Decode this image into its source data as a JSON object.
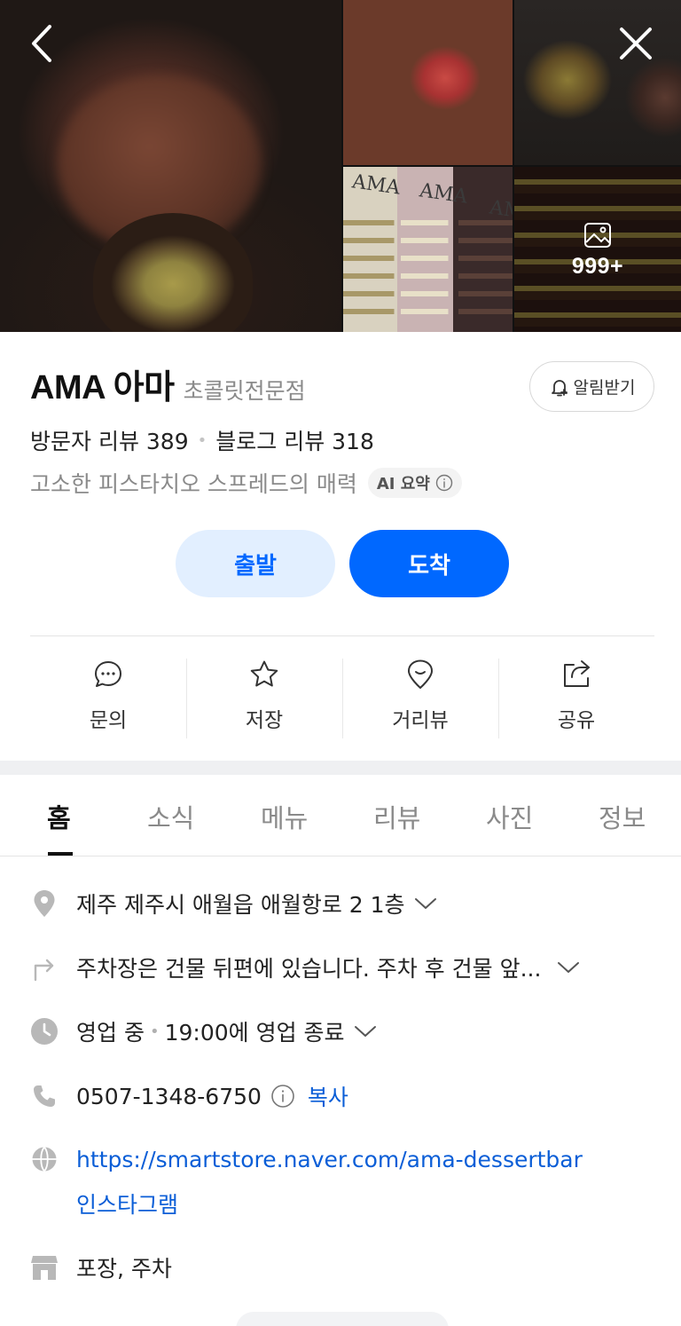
{
  "gallery": {
    "photo_count": "999+",
    "photo_labels": [
      "AMA",
      "AMA",
      "AM"
    ]
  },
  "header": {
    "name": "AMA 아마",
    "category": "초콜릿전문점",
    "alert_label": "알림받기",
    "visitor_reviews": "방문자 리뷰 389",
    "blog_reviews": "블로그 리뷰 318",
    "summary": "고소한 피스타치오 스프레드의 매력",
    "ai_badge": "AI 요약"
  },
  "directions": {
    "depart_label": "출발",
    "arrive_label": "도착"
  },
  "actions": [
    {
      "label": "문의",
      "icon": "chat-icon"
    },
    {
      "label": "저장",
      "icon": "star-icon"
    },
    {
      "label": "거리뷰",
      "icon": "map-pin-icon"
    },
    {
      "label": "공유",
      "icon": "share-icon"
    }
  ],
  "tabs": [
    {
      "label": "홈",
      "active": true
    },
    {
      "label": "소식"
    },
    {
      "label": "메뉴"
    },
    {
      "label": "리뷰"
    },
    {
      "label": "사진"
    },
    {
      "label": "정보"
    }
  ],
  "info": {
    "address": "제주 제주시 애월읍 애월항로 2 1층",
    "directions_note": "주차장은 건물 뒤편에 있습니다. 주차 후 건물 앞...",
    "hours_status": "영업 중",
    "hours_detail": "19:00에 영업 종료",
    "phone": "0507-1348-6750",
    "copy_label": "복사",
    "website": "https://smartstore.naver.com/ama-dessertbar",
    "instagram": "인스타그램",
    "amenities": "포장, 주차"
  },
  "colors": {
    "accent": "#0068ff",
    "accent_light": "#e2efff",
    "link": "#0b5ed7",
    "muted_text": "#8a8a8a"
  }
}
